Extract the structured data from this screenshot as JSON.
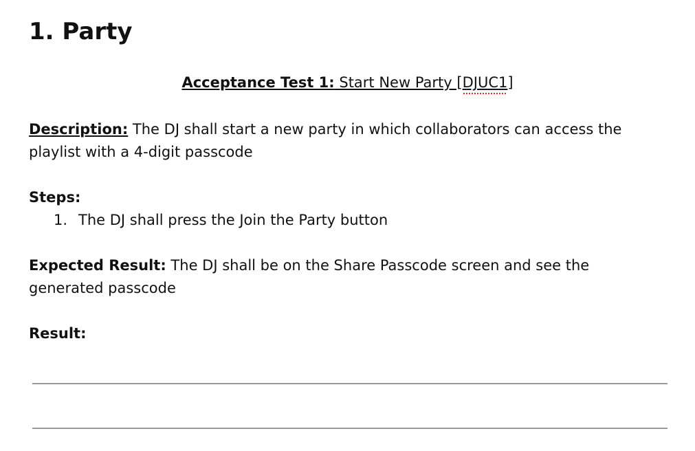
{
  "section": {
    "heading": "1. Party"
  },
  "test": {
    "label": "Acceptance Test 1:",
    "name_prefix": " Start New Party [",
    "code": "DJUC1",
    "name_suffix": "]"
  },
  "description": {
    "label": "Description:",
    "text": " The DJ shall start a new party in which collaborators can access the playlist with a 4-digit passcode"
  },
  "steps": {
    "label": "Steps:",
    "items": [
      {
        "number": "1.",
        "text": "The DJ shall press the Join the Party button"
      }
    ]
  },
  "expected": {
    "label": "Expected Result:",
    "text": " The DJ shall be on the Share Passcode screen and see the generated passcode"
  },
  "result": {
    "label": "Result:"
  }
}
